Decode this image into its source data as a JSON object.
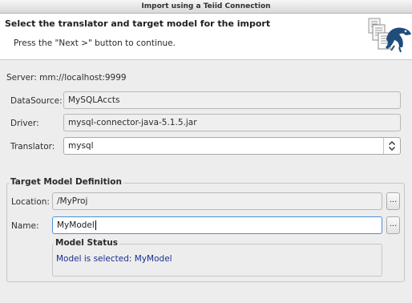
{
  "window": {
    "title": "Import using a Teiid Connection"
  },
  "header": {
    "title": "Select the translator and target model for the import",
    "description": "Press the \"Next >\" button to continue."
  },
  "server": {
    "label": "Server: mm://localhost:9999"
  },
  "datasource": {
    "label": "DataSource:",
    "value": "MySQLAccts"
  },
  "driver": {
    "label": "Driver:",
    "value": "mysql-connector-java-5.1.5.jar"
  },
  "translator": {
    "label": "Translator:",
    "value": "mysql"
  },
  "target": {
    "group_title": "Target Model Definition",
    "location_label": "Location:",
    "location_value": "/MyProj",
    "browse_label": "...",
    "name_label": "Name:",
    "name_value": "MyModel"
  },
  "status": {
    "group_title": "Model Status",
    "message": "Model is selected: MyModel",
    "color": "#1a2f8c"
  },
  "icons": {
    "header": "import-documents-teiid-icon",
    "combo": "up-down-chevron-icon"
  }
}
